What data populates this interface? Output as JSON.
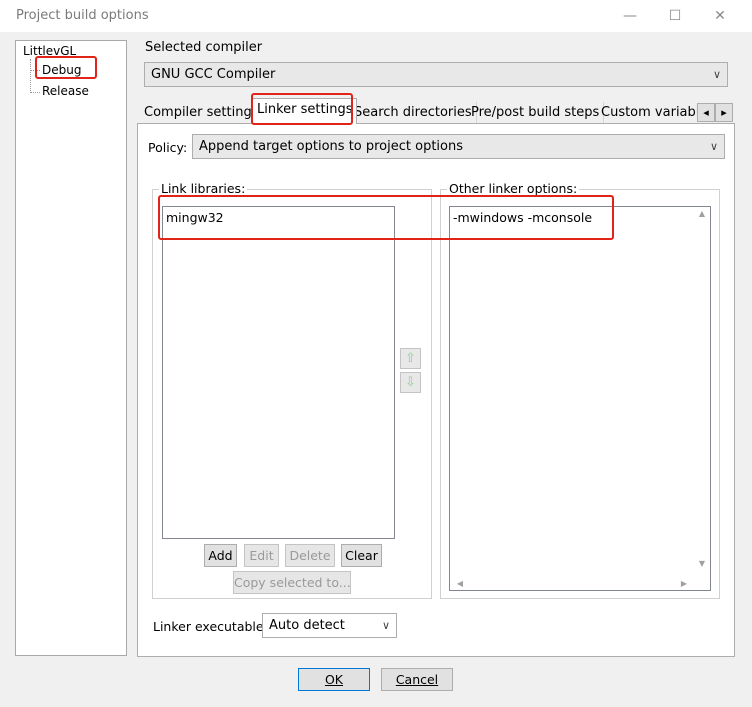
{
  "window": {
    "title": "Project build options",
    "minimize_icon": "minimize-icon",
    "maximize_icon": "maximize-icon",
    "close_icon": "close-icon"
  },
  "tree": {
    "root": "LittlevGL",
    "children": [
      "Debug",
      "Release"
    ],
    "selected": "Debug"
  },
  "compiler": {
    "label": "Selected compiler",
    "value": "GNU GCC Compiler"
  },
  "tabs": [
    {
      "label": "Compiler settings"
    },
    {
      "label": "Linker settings",
      "active": true
    },
    {
      "label": "Search directories"
    },
    {
      "label": "Pre/post build steps"
    },
    {
      "label": "Custom variable"
    }
  ],
  "tab_scroll": {
    "left": "◂",
    "right": "▸"
  },
  "policy": {
    "label": "Policy:",
    "value": "Append target options to project options"
  },
  "link_libraries": {
    "label": "Link libraries:",
    "items": [
      "mingw32"
    ]
  },
  "other_linker_options": {
    "label": "Other linker options:",
    "value": "-mwindows -mconsole"
  },
  "move": {
    "up_icon": "arrow-up-icon",
    "down_icon": "arrow-down-icon"
  },
  "library_buttons": {
    "add": "Add",
    "edit": "Edit",
    "delete": "Delete",
    "clear": "Clear",
    "copy": "Copy selected to..."
  },
  "linker_executable": {
    "label": "Linker executable:",
    "value": "Auto detect"
  },
  "dialog_buttons": {
    "ok": "OK",
    "cancel": "Cancel"
  },
  "colors": {
    "highlight": "#e2231a",
    "arrow_green": "#8fcf8f"
  }
}
